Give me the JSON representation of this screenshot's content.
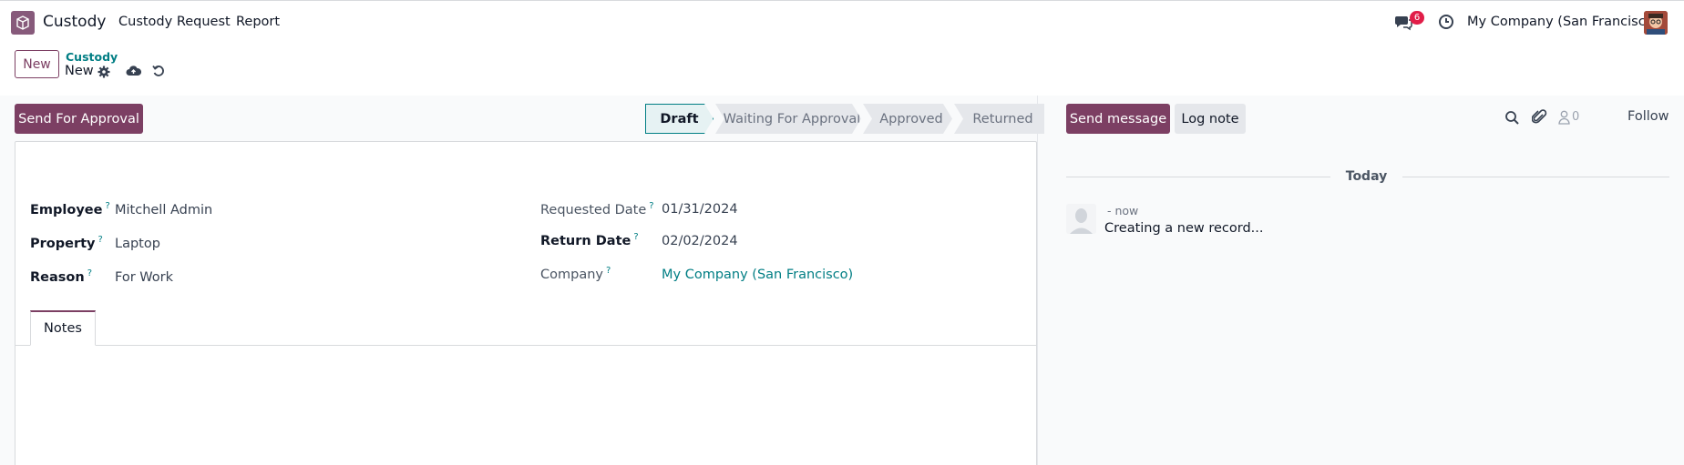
{
  "topbar": {
    "app_name": "Custody",
    "menu": [
      "Custody Request",
      "Report"
    ],
    "chat_badge": "6",
    "company": "My Company (San Francisco)"
  },
  "control": {
    "new_label": "New",
    "breadcrumb_parent": "Custody",
    "breadcrumb_current": "New"
  },
  "statusbar": {
    "action_label": "Send For Approval",
    "stages": [
      "Draft",
      "Waiting For Approval",
      "Approved",
      "Returned"
    ],
    "active_stage": "Draft"
  },
  "form": {
    "employee_label": "Employee",
    "employee_value": "Mitchell Admin",
    "property_label": "Property",
    "property_value": "Laptop",
    "reason_label": "Reason",
    "reason_value": "For Work",
    "requested_date_label": "Requested Date",
    "requested_date_value": "01/31/2024",
    "return_date_label": "Return Date",
    "return_date_value": "02/02/2024",
    "company_label": "Company",
    "company_value": "My Company (San Francisco)",
    "help_mark": "?",
    "tab_notes": "Notes"
  },
  "chatter": {
    "send_message": "Send message",
    "log_note": "Log note",
    "follower_count": "0",
    "follow": "Follow",
    "date_separator": "Today",
    "message_time": "- now",
    "message_body": "Creating a new record..."
  },
  "colors": {
    "brand": "#7c3f63",
    "link": "#017e84",
    "badge": "#e11d48"
  },
  "icons": [
    "app-logo-icon",
    "chat-icon",
    "clock-icon",
    "gear-icon",
    "cloud-upload-icon",
    "discard-icon",
    "search-icon",
    "paperclip-icon",
    "follower-icon",
    "user-avatar"
  ]
}
